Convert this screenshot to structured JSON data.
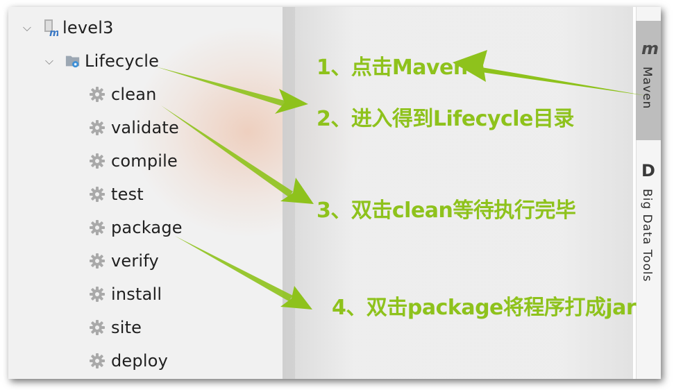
{
  "tree": {
    "project": {
      "label": "level3",
      "icon": "maven-module-icon"
    },
    "lifecycle": {
      "label": "Lifecycle",
      "icon": "lifecycle-folder-icon"
    },
    "phases": [
      "clean",
      "validate",
      "compile",
      "test",
      "package",
      "verify",
      "install",
      "site",
      "deploy"
    ]
  },
  "sidebar": {
    "maven_tab": "Maven",
    "maven_logo": "m",
    "bigdata_tab": "Big Data Tools",
    "bigdata_logo": "D"
  },
  "annotations": {
    "step1": "1、点击Maven",
    "step2": "2、进入得到Lifecycle目录",
    "step3": "3、双击clean等待执行完毕",
    "step4": "4、双击package将程序打成jar"
  },
  "colors": {
    "annotation": "#8ec21c",
    "sidebar_active": "#bdbdbd"
  }
}
